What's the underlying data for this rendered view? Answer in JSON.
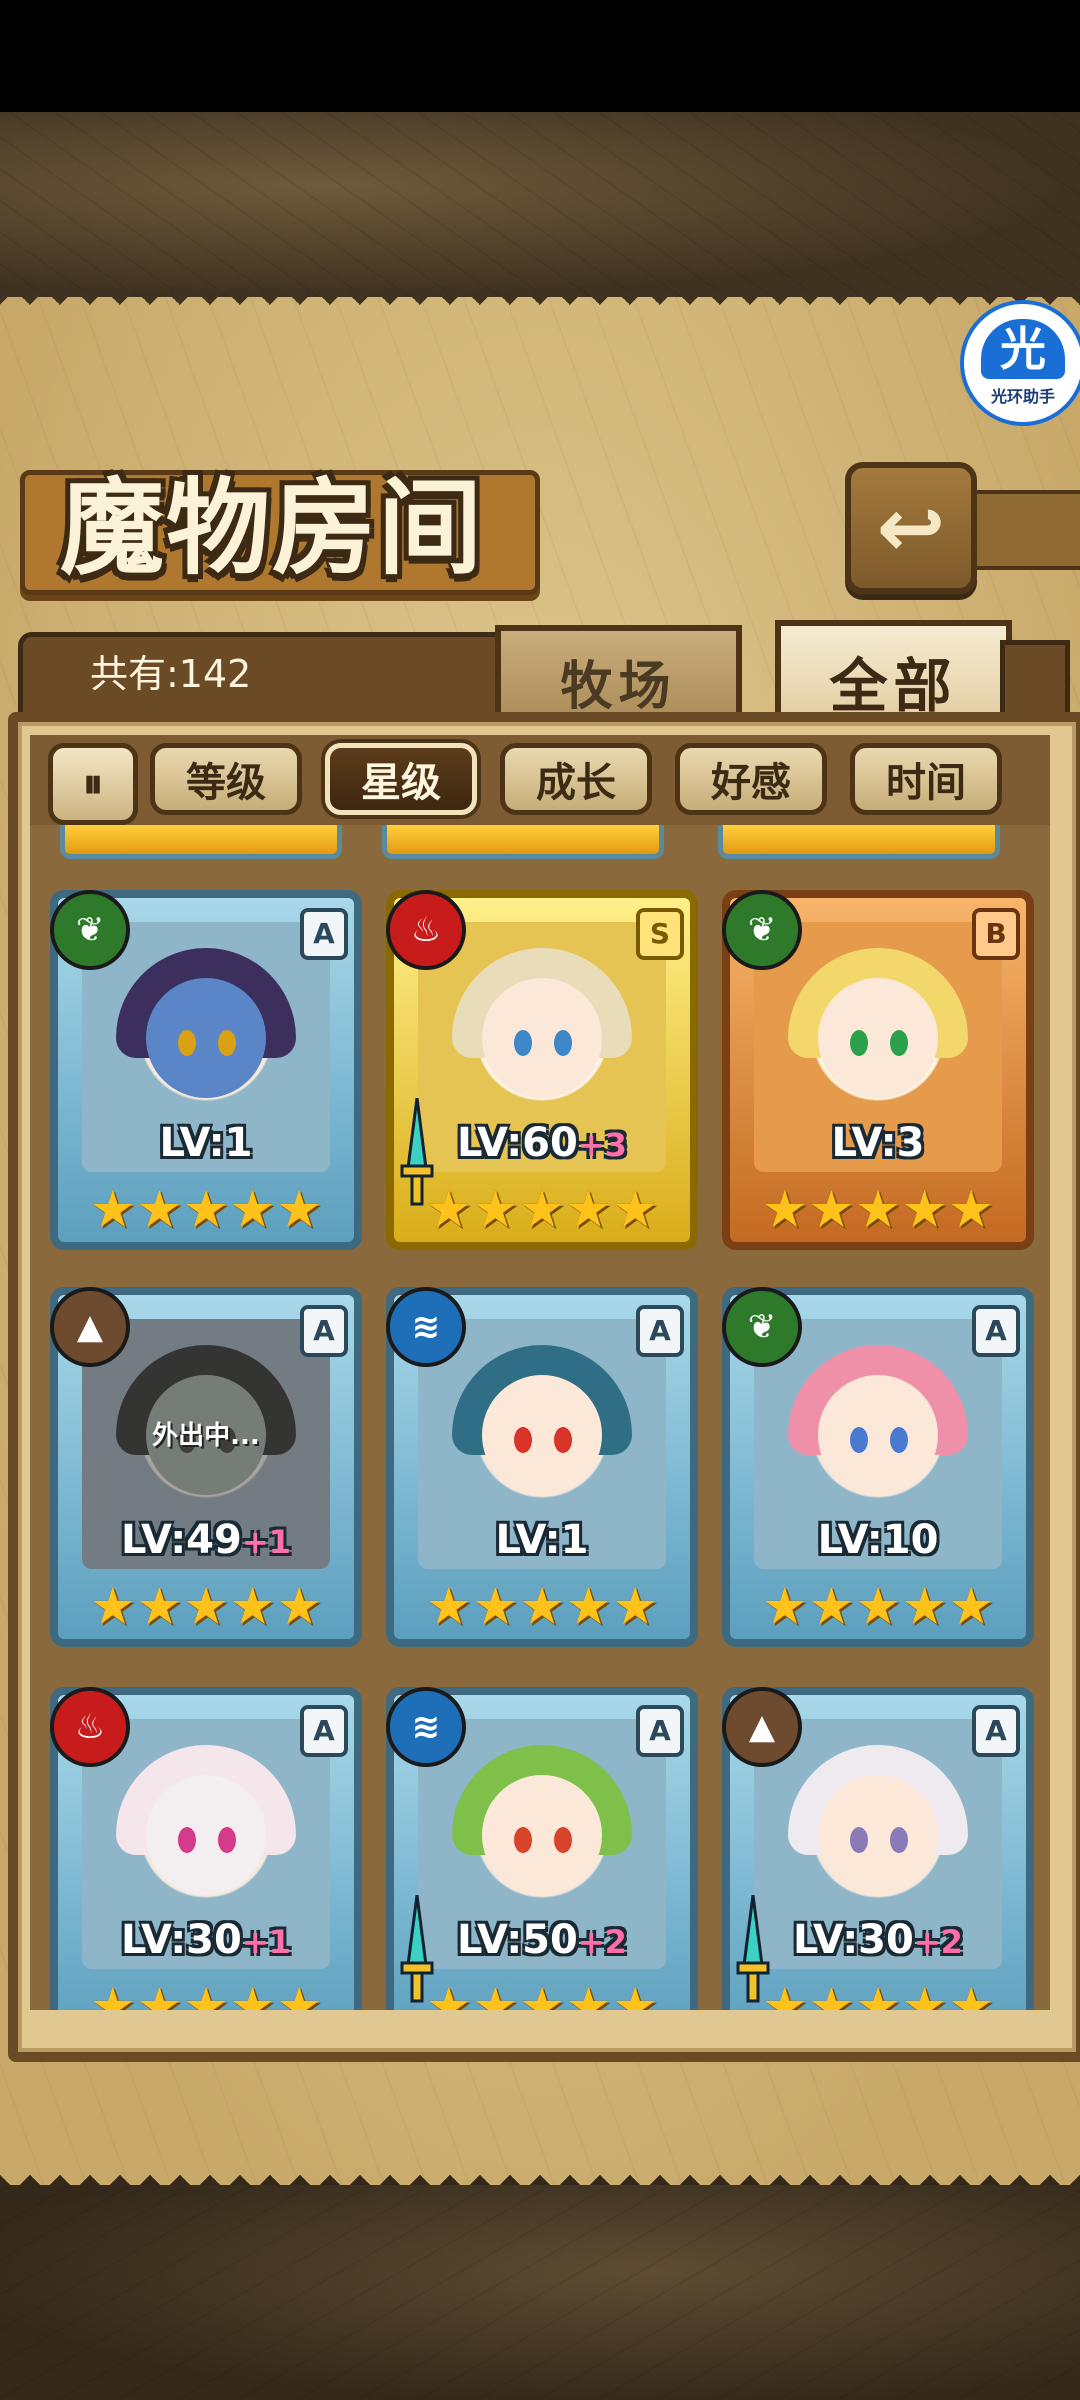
{
  "header": {
    "title": "魔物房间",
    "helper_badge": {
      "glyph": "光",
      "label": "光环助手"
    }
  },
  "tabs": {
    "count_text": "共有:142",
    "pasture_label": "牧场",
    "all_label": "全部"
  },
  "filters": {
    "toggle_symbol": "⏸",
    "items": [
      {
        "label": "等级",
        "active": false
      },
      {
        "label": "星级",
        "active": true
      },
      {
        "label": "成长",
        "active": false
      },
      {
        "label": "好感",
        "active": false
      },
      {
        "label": "时间",
        "active": false
      }
    ]
  },
  "monsters": [
    {
      "element": "leaf",
      "rank": "A",
      "level": "LV:1",
      "plus": "",
      "stars": "★★★★★",
      "frame": "blue",
      "equipped": false,
      "status": "",
      "skin": "#5a86c8",
      "hair": "#3c2f5e",
      "eyes": "#d8a012"
    },
    {
      "element": "fire",
      "rank": "S",
      "level": "LV:60",
      "plus": "+3",
      "stars": "★★★★★",
      "frame": "gold",
      "equipped": true,
      "status": "",
      "skin": "#fbe8d8",
      "hair": "#e9dcb8",
      "eyes": "#3d86c8"
    },
    {
      "element": "leaf",
      "rank": "B",
      "level": "LV:3",
      "plus": "",
      "stars": "★★★★★",
      "frame": "bronze",
      "equipped": false,
      "status": "",
      "skin": "#fbe8d8",
      "hair": "#f2d86a",
      "eyes": "#2aa04a"
    },
    {
      "element": "earth",
      "rank": "A",
      "level": "LV:49",
      "plus": "+1",
      "stars": "★★★★★",
      "frame": "blue",
      "equipped": false,
      "status": "外出中...",
      "skin": "#9fb6a0",
      "hair": "#4c4a44",
      "eyes": "#555555"
    },
    {
      "element": "water",
      "rank": "A",
      "level": "LV:1",
      "plus": "",
      "stars": "★★★★★",
      "frame": "blue",
      "equipped": false,
      "status": "",
      "skin": "#fbe8d8",
      "hair": "#2f6e84",
      "eyes": "#d8342a"
    },
    {
      "element": "leaf",
      "rank": "A",
      "level": "LV:10",
      "plus": "",
      "stars": "★★★★★",
      "frame": "blue",
      "equipped": false,
      "status": "",
      "skin": "#fbe8d8",
      "hair": "#f08fa8",
      "eyes": "#4a7ad0"
    },
    {
      "element": "fire",
      "rank": "A",
      "level": "LV:30",
      "plus": "+1",
      "stars": "★★★★★",
      "frame": "blue",
      "equipped": false,
      "status": "",
      "skin": "#f3eef0",
      "hair": "#f4e6ea",
      "eyes": "#d63a8a"
    },
    {
      "element": "water",
      "rank": "A",
      "level": "LV:50",
      "plus": "+2",
      "stars": "★★★★★",
      "frame": "blue",
      "equipped": true,
      "status": "",
      "skin": "#fbe8d8",
      "hair": "#7fc04a",
      "eyes": "#d8442a"
    },
    {
      "element": "earth",
      "rank": "A",
      "level": "LV:30",
      "plus": "+2",
      "stars": "★★★★★",
      "frame": "blue",
      "equipped": true,
      "status": "",
      "skin": "#fbe8d8",
      "hair": "#eeeaf0",
      "eyes": "#8a7ab8"
    }
  ],
  "colors": {
    "parchment": "#d9bf83",
    "wood": "#6b4a26",
    "star": "#ffc21a",
    "plus": "#ff6fa8"
  }
}
